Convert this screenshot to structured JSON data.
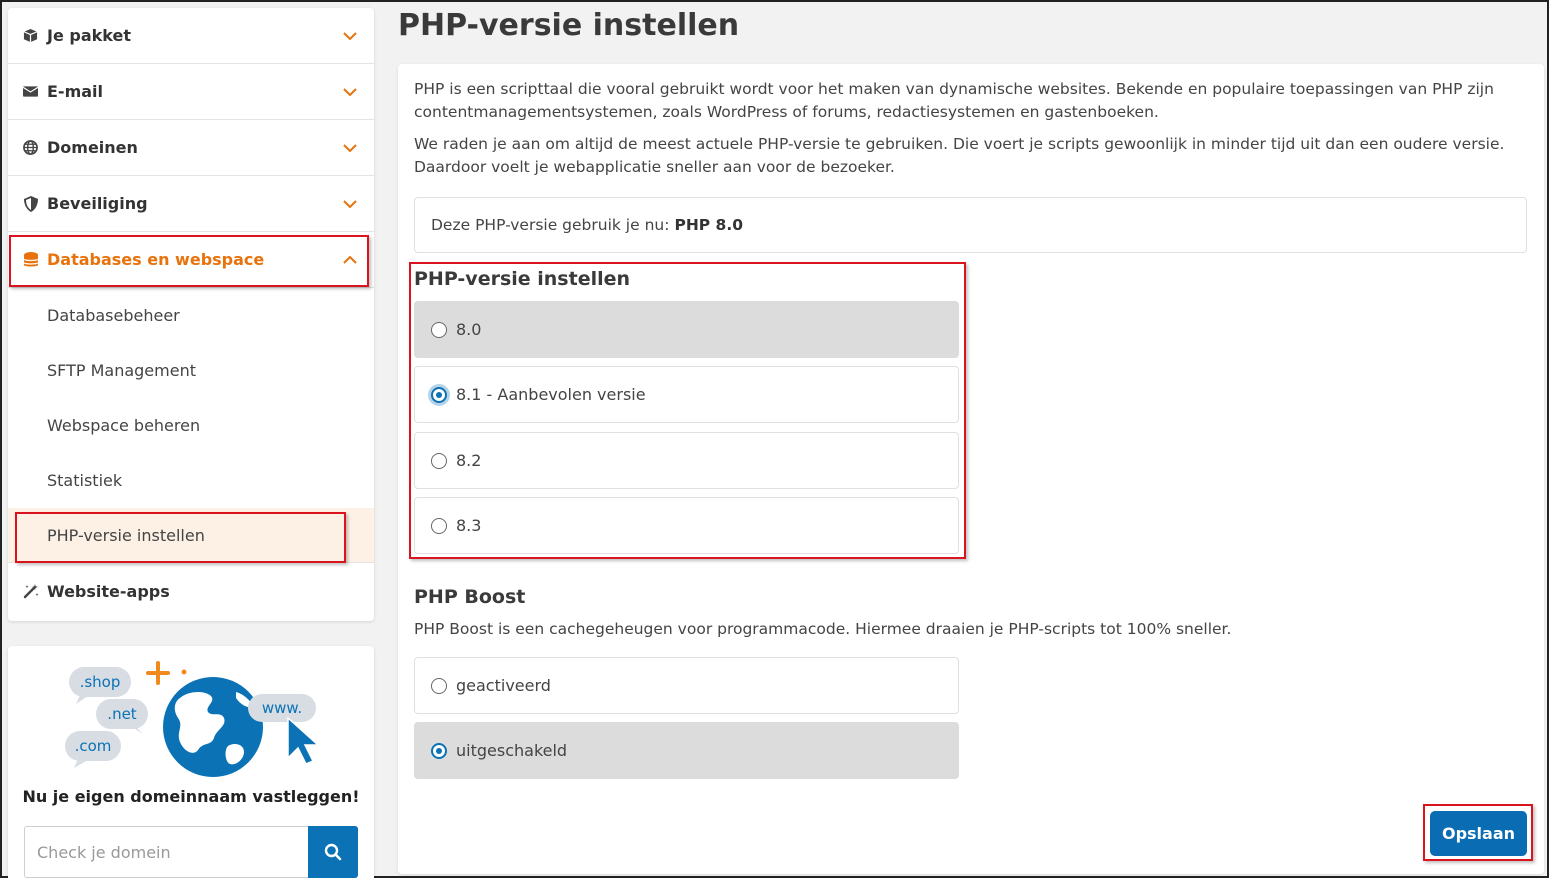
{
  "sidebar": {
    "items": [
      {
        "label": "Je pakket",
        "icon": "package-icon"
      },
      {
        "label": "E-mail",
        "icon": "envelope-icon"
      },
      {
        "label": "Domeinen",
        "icon": "globe-icon"
      },
      {
        "label": "Beveiliging",
        "icon": "shield-icon"
      },
      {
        "label": "Databases en webspace",
        "icon": "database-icon"
      }
    ],
    "subitems": [
      {
        "label": "Databasebeheer"
      },
      {
        "label": "SFTP Management"
      },
      {
        "label": "Webspace beheren"
      },
      {
        "label": "Statistiek"
      },
      {
        "label": "PHP-versie instellen"
      }
    ],
    "apps_item": {
      "label": "Website-apps",
      "icon": "magic-wand-icon"
    }
  },
  "promo": {
    "tld_bubbles": [
      ".shop",
      ".net",
      ".com",
      "www."
    ],
    "title": "Nu je eigen domeinnaam vastleggen!",
    "search_placeholder": "Check je domein"
  },
  "page": {
    "title": "PHP-versie instellen",
    "intro_1": "PHP is een scripttaal die vooral gebruikt wordt voor het maken van dynamische websites. Bekende en populaire toepassingen van PHP zijn contentmanagementsystemen, zoals WordPress of forums, redactiesystemen en gastenboeken.",
    "intro_2": "We raden je aan om altijd de meest actuele PHP-versie te gebruiken. Die voert je scripts gewoonlijk in minder tijd uit dan een oudere versie. Daardoor voelt je webapplicatie sneller aan voor de bezoeker.",
    "current_label": "Deze PHP-versie gebruik je nu:",
    "current_value": "PHP 8.0",
    "version_section_title": "PHP-versie instellen",
    "versions": [
      {
        "label": "8.0",
        "selected": false
      },
      {
        "label": "8.1 - Aanbevolen versie",
        "selected": true
      },
      {
        "label": "8.2",
        "selected": false
      },
      {
        "label": "8.3",
        "selected": false
      }
    ],
    "boost_title": "PHP Boost",
    "boost_desc": "PHP Boost is een cachegeheugen voor programmacode. Hiermee draaien je PHP-scripts tot 100% sneller.",
    "boost_options": [
      {
        "label": "geactiveerd",
        "selected": false
      },
      {
        "label": "uitgeschakeld",
        "selected": true
      }
    ],
    "save_label": "Opslaan"
  },
  "colors": {
    "accent_orange": "#e8730c",
    "primary_blue": "#0a6cb3",
    "highlight_red": "#d9141e"
  }
}
